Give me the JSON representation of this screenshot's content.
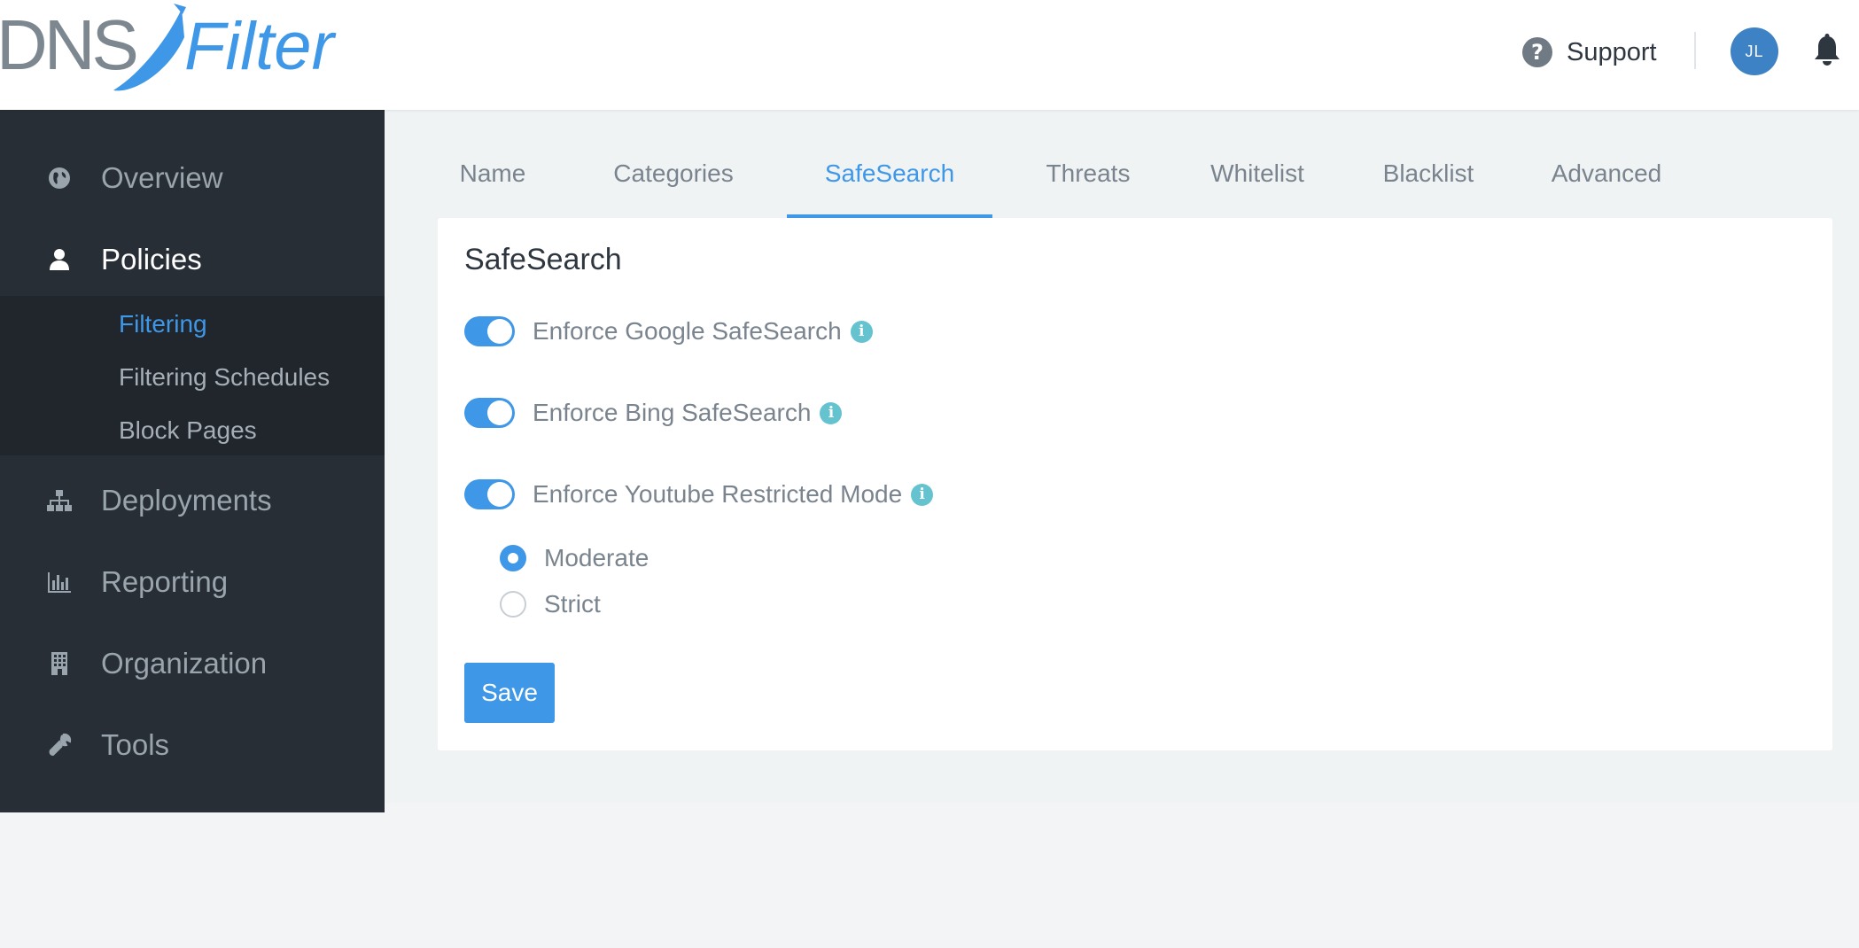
{
  "brand": {
    "logo_text_left": "DNS",
    "logo_text_right": "Filter",
    "logo_gray": "#7d8790",
    "logo_blue": "#3f97e8"
  },
  "header": {
    "support_label": "Support",
    "support_icon": "question-circle-icon",
    "avatar_initials": "JL",
    "notification_icon": "bell-icon"
  },
  "sidebar": {
    "items": [
      {
        "label": "Overview",
        "icon": "globe-icon"
      },
      {
        "label": "Policies",
        "icon": "user-icon",
        "active": true
      },
      {
        "label": "Deployments",
        "icon": "sitemap-icon"
      },
      {
        "label": "Reporting",
        "icon": "bar-chart-icon"
      },
      {
        "label": "Organization",
        "icon": "building-icon"
      },
      {
        "label": "Tools",
        "icon": "wrench-icon"
      }
    ],
    "subitems": [
      {
        "label": "Filtering",
        "active": true
      },
      {
        "label": "Filtering Schedules"
      },
      {
        "label": "Block Pages"
      }
    ]
  },
  "tabs": [
    {
      "label": "Name"
    },
    {
      "label": "Categories"
    },
    {
      "label": "SafeSearch",
      "active": true
    },
    {
      "label": "Threats"
    },
    {
      "label": "Whitelist"
    },
    {
      "label": "Blacklist"
    },
    {
      "label": "Advanced"
    }
  ],
  "safesearch": {
    "title": "SafeSearch",
    "toggles": [
      {
        "label": "Enforce Google SafeSearch",
        "on": true
      },
      {
        "label": "Enforce Bing SafeSearch",
        "on": true
      },
      {
        "label": "Enforce Youtube Restricted Mode",
        "on": true
      }
    ],
    "info_glyph": "i",
    "youtube_modes": [
      {
        "label": "Moderate",
        "selected": true
      },
      {
        "label": "Strict",
        "selected": false
      }
    ],
    "save_label": "Save"
  },
  "colors": {
    "accent": "#3f97e8",
    "sidebar_bg": "#272e35",
    "sidebar_sub_bg": "#20262c",
    "info": "#64c3cf",
    "avatar": "#3d82c4"
  }
}
